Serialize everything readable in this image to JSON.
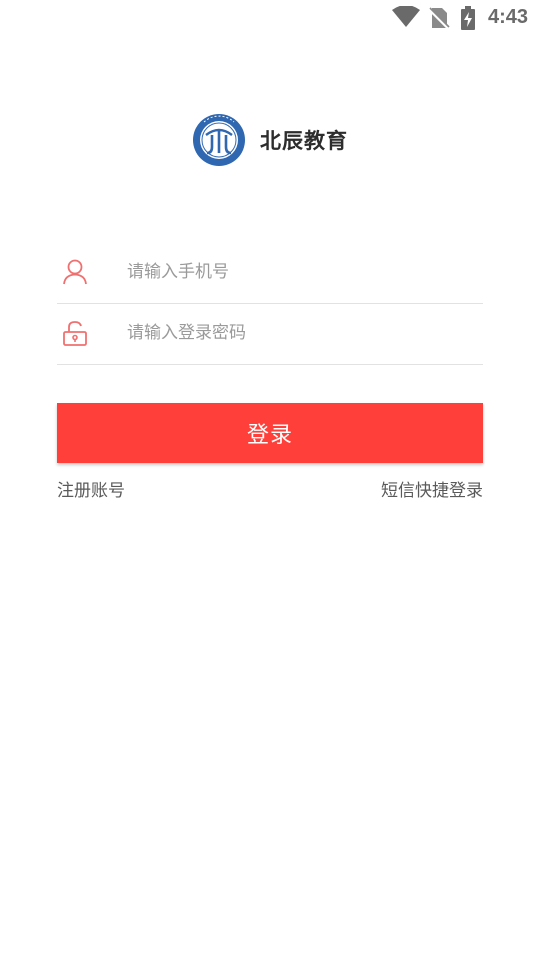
{
  "status_bar": {
    "time": "4:43",
    "icons": [
      "wifi-icon",
      "no-sim-icon",
      "battery-charging-icon"
    ]
  },
  "brand": {
    "name": "北辰教育",
    "logo_text_ring": "BEI CHEN LIN XUAN",
    "logo_text_bottom": "北辰教育",
    "logo_icon": "beichen-logo"
  },
  "form": {
    "phone": {
      "placeholder": "请输入手机号",
      "value": "",
      "icon": "user-icon"
    },
    "password": {
      "placeholder": "请输入登录密码",
      "value": "",
      "icon": "unlock-icon"
    }
  },
  "actions": {
    "login_label": "登录",
    "register_label": "注册账号",
    "sms_login_label": "短信快捷登录"
  },
  "colors": {
    "accent": "#ff403a",
    "icon": "#f07070",
    "logo_blue": "#2f67b0"
  }
}
